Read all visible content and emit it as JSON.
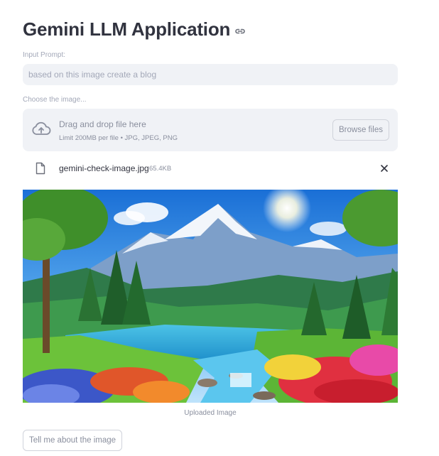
{
  "header": {
    "title": "Gemini LLM Application",
    "link_icon": "link-icon"
  },
  "prompt": {
    "label": "Input Prompt:",
    "value": "based on this image create a blog"
  },
  "uploader": {
    "label": "Choose the image...",
    "drop_text": "Drag and drop file here",
    "limit_text": "Limit 200MB per file • JPG, JPEG, PNG",
    "browse_label": "Browse files",
    "icon": "cloud-upload-icon"
  },
  "uploaded_file": {
    "name": "gemini-check-image.jpg",
    "size": "65.4KB",
    "icon": "file-icon",
    "remove_icon": "close-icon"
  },
  "image": {
    "caption": "Uploaded Image"
  },
  "submit": {
    "label": "Tell me about the image"
  },
  "colors": {
    "input_bg": "#f0f2f6",
    "text_primary": "#31333f",
    "text_muted": "#a3a8b8",
    "border": "#d0d3db"
  }
}
